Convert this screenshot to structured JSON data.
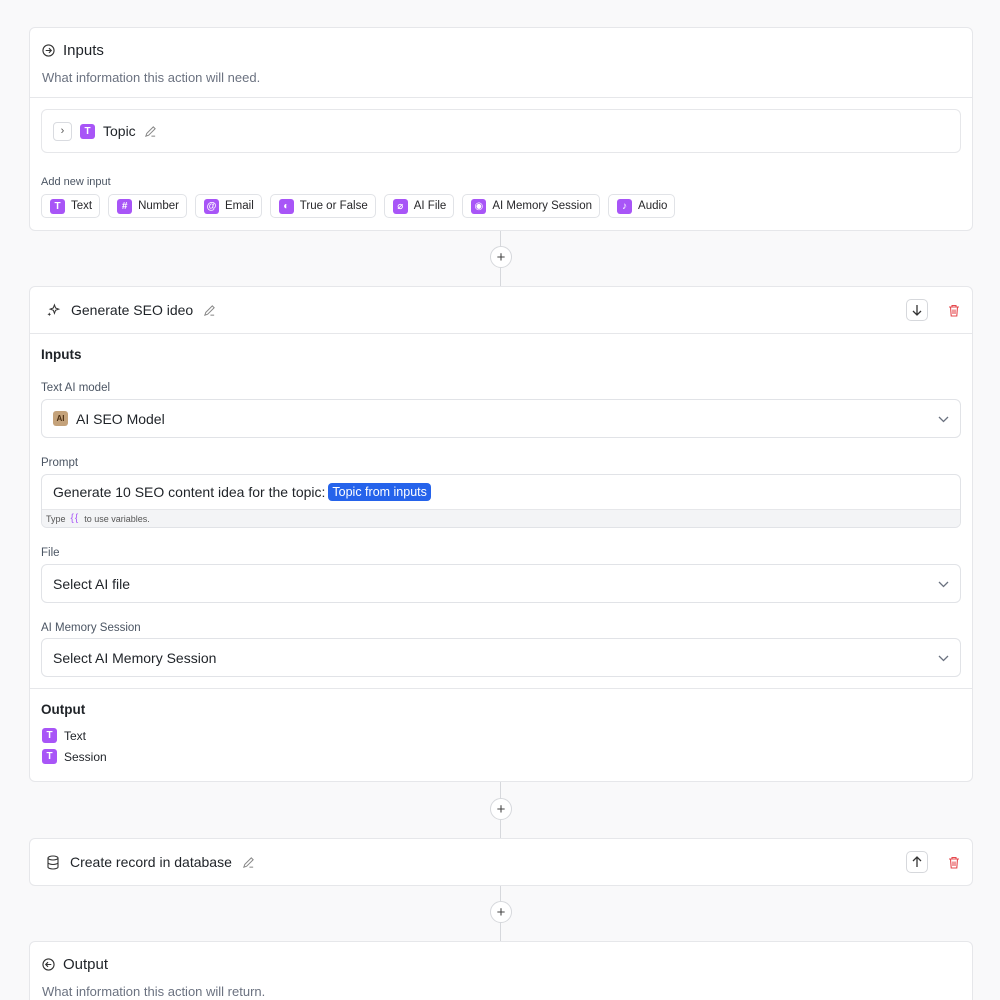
{
  "inputs_card": {
    "title": "Inputs",
    "subtitle": "What information this action will need.",
    "topic_label": "Topic",
    "add_new_label": "Add new input",
    "chips": [
      {
        "label": "Text",
        "icon": "text-icon",
        "glyph": "T"
      },
      {
        "label": "Number",
        "icon": "hash-icon",
        "glyph": "#"
      },
      {
        "label": "Email",
        "icon": "at-icon",
        "glyph": "@"
      },
      {
        "label": "True or False",
        "icon": "toggle-icon",
        "glyph": "◐"
      },
      {
        "label": "AI File",
        "icon": "paperclip-icon",
        "glyph": "⌀"
      },
      {
        "label": "AI Memory Session",
        "icon": "memory-icon",
        "glyph": "◉"
      },
      {
        "label": "Audio",
        "icon": "mic-icon",
        "glyph": "♪"
      }
    ]
  },
  "generate_card": {
    "title": "Generate SEO ideo",
    "inputs_heading": "Inputs",
    "text_model_label": "Text AI model",
    "text_model_badge": "AI",
    "text_model_value": "AI SEO Model",
    "prompt_label": "Prompt",
    "prompt_text": "Generate 10 SEO content idea for the topic:",
    "prompt_variable": "Topic from inputs",
    "prompt_hint_prefix": "Type",
    "prompt_hint_braces": "{{",
    "prompt_hint_suffix": "to use variables.",
    "file_label": "File",
    "file_placeholder": "Select AI file",
    "memory_label": "AI Memory Session",
    "memory_placeholder": "Select AI Memory Session",
    "output_heading": "Output",
    "outputs": [
      "Text",
      "Session"
    ]
  },
  "db_card": {
    "title": "Create record in database"
  },
  "output_card": {
    "title": "Output",
    "subtitle": "What information this action will return."
  },
  "colors": {
    "accent_purple": "#a855f7",
    "variable_blue": "#2563eb",
    "danger_red": "#e5484d"
  }
}
